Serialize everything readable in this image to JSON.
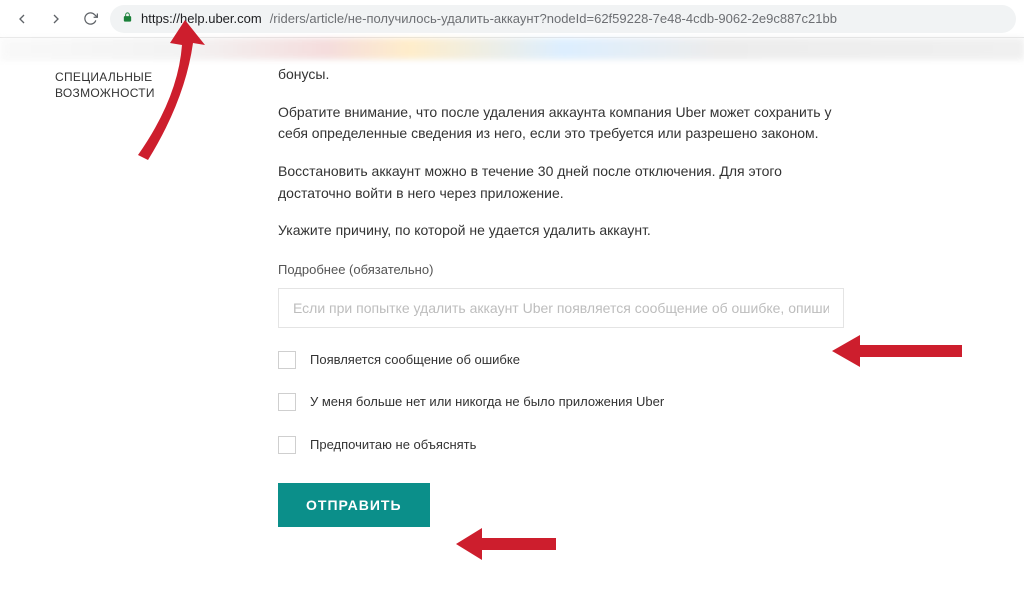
{
  "browser": {
    "url_host": "https://help.uber.com",
    "url_path": "/riders/article/не-получилось-удалить-аккаунт?nodeId=62f59228-7e48-4cdb-9062-2e9c887c21bb"
  },
  "sidebar": {
    "item_line1": "СПЕЦИАЛЬНЫЕ",
    "item_line2": "ВОЗМОЖНОСТИ"
  },
  "article": {
    "p0": "бонусы.",
    "p1": "Обратите внимание, что после удаления аккаунта компания Uber может сохранить у себя определенные сведения из него, если это требуется или разрешено законом.",
    "p2": "Восстановить аккаунт можно в течение 30 дней после отключения. Для этого достаточно войти в него через приложение.",
    "p3": "Укажите причину, по которой не удается удалить аккаунт."
  },
  "form": {
    "details_label": "Подробнее (обязательно)",
    "details_placeholder": "Если при попытке удалить аккаунт Uber появляется сообщение об ошибке, опиши",
    "cb1_label": "Появляется сообщение об ошибке",
    "cb2_label": "У меня больше нет или никогда не было приложения Uber",
    "cb3_label": "Предпочитаю не объяснять",
    "submit_label": "ОТПРАВИТЬ"
  }
}
